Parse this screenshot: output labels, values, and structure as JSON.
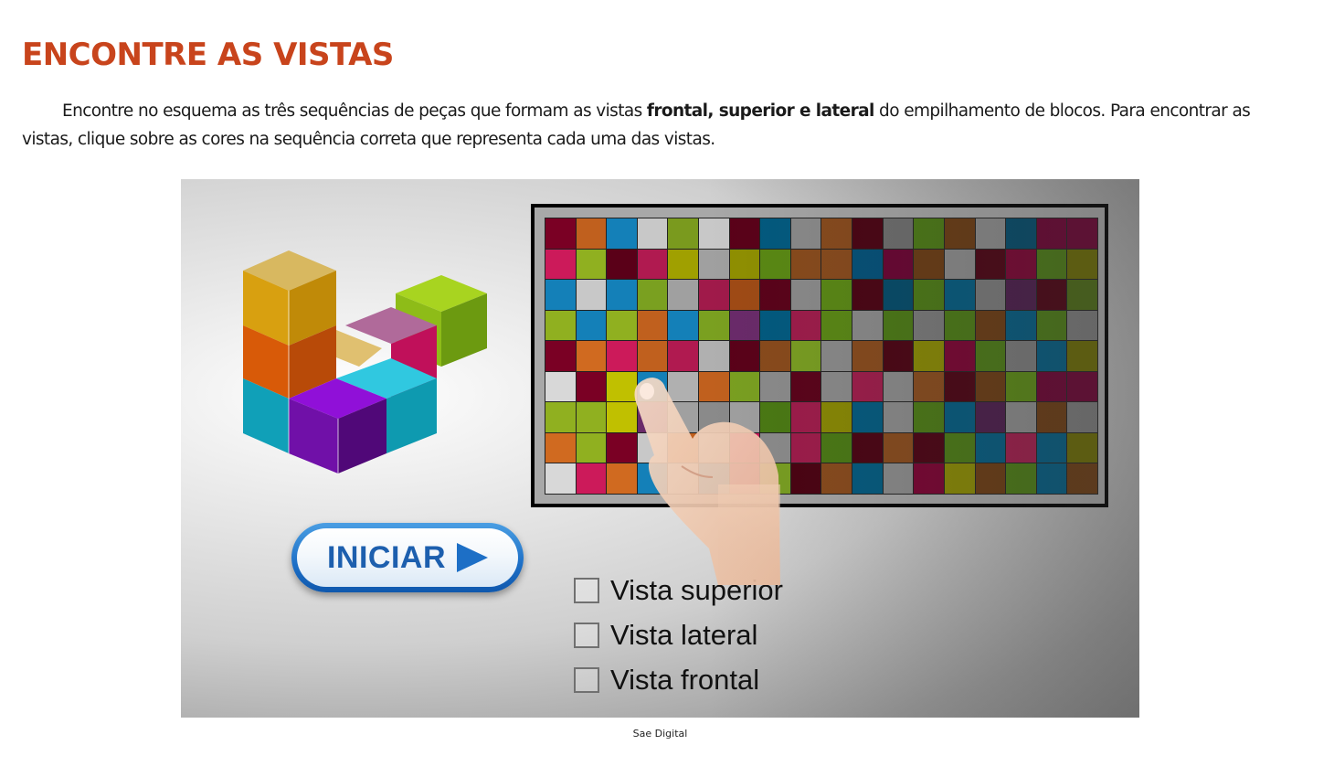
{
  "page": {
    "title": "ENCONTRE AS VISTAS",
    "intro": {
      "part1": "Encontre no esquema as três sequências de peças que formam as vistas ",
      "bold": "frontal, superior e lateral",
      "part2": " do empilhamento de blocos. Para encontrar as vistas, clique sobre as cores na sequência correta que representa cada uma das vistas."
    },
    "credit": "Sae Digital"
  },
  "game": {
    "start_label": "INICIAR",
    "options": [
      {
        "label": "Vista superior",
        "checked": false
      },
      {
        "label": "Vista lateral",
        "checked": false
      },
      {
        "label": "Vista frontal",
        "checked": false
      }
    ],
    "grid": {
      "rows": 9,
      "cols": 18,
      "cells": [
        [
          "#7a0024",
          "#c0601e",
          "#1480b8",
          "#c8c8c8",
          "#7a9a1e",
          "#c8c8c8",
          "#5a0018",
          "#005a80",
          "#8c8c8c",
          "#8a4a1a",
          "#4a0010",
          "#6e6e6e",
          "#4a7a12",
          "#6a3a10",
          "#8c8c8c",
          "#004a6a",
          "#6a0030"
        ],
        [
          "#cc1a5a",
          "#90b020",
          "#5a0018",
          "#b01a50",
          "#a0a000",
          "#a0a0a0",
          "#909000",
          "#5a8a12",
          "#8a4a1a",
          "#8a4a1a",
          "#00507a",
          "#6a0030",
          "#6a3a10",
          "#8c8c8c",
          "#4a0010",
          "#7a0030",
          "#4a7a12",
          "#6a6a00"
        ],
        [
          "#1480b8",
          "#c8c8c8",
          "#1480b8",
          "#7aa020",
          "#a0a0a0",
          "#a01a4a",
          "#a04a14",
          "#5a0018",
          "#8c8c8c",
          "#5a8a12",
          "#4a0010",
          "#004a6a",
          "#4a7a12",
          "#005a80",
          "#7a7a7a",
          "#4a1a4a",
          "#4a0010",
          "#4a6a12"
        ],
        [
          "#90b020",
          "#1480b8",
          "#90b020",
          "#c0601e",
          "#1480b8",
          "#7aa020",
          "#6a2a6a",
          "#005a80",
          "#a01a4a",
          "#5a8a12",
          "#8c8c8c",
          "#4a7a12",
          "#7a7a7a",
          "#4a7a12",
          "#6a3a10",
          "#005a80",
          "#4a7a12",
          "#7a7a7a"
        ],
        [
          "#7a0024",
          "#d06a20",
          "#cc1a5a",
          "#c0601e",
          "#b01a50",
          "#b0b0b0",
          "#5a0018",
          "#8a4a1a",
          "#7aa020",
          "#8c8c8c",
          "#8a4a1a",
          "#4a0010",
          "#8a8a00",
          "#7a0030",
          "#4a7a12",
          "#7a7a7a",
          "#005a80",
          "#6a6a00"
        ],
        [
          "#d8d8d8",
          "#7a0024",
          "#c0c000",
          "#1480b8",
          "#b0b0b0",
          "#c0601e",
          "#7aa020",
          "#8c8c8c",
          "#5a0018",
          "#8c8c8c",
          "#a01a4a",
          "#8c8c8c",
          "#8a4a1a",
          "#4a0010",
          "#6a3a10",
          "#5a8a12",
          "#6a0030"
        ],
        [
          "#90b020",
          "#90b020",
          "#c0c000",
          "#6a2a6a",
          "#a0a0a0",
          "#8a8a8a",
          "#a0a0a0",
          "#4a7a12",
          "#a01a4a",
          "#8a8a00",
          "#005a80",
          "#8c8c8c",
          "#4a7a12",
          "#005a80",
          "#4a1a4a",
          "#8c8c8c",
          "#6a3a10",
          "#7a7a7a",
          "#4a0010"
        ],
        [
          "#d06a20",
          "#90b020",
          "#7a0024",
          "#c8c8c8",
          "#c0601e",
          "#b0b0b0",
          "#cc1a5a",
          "#8c8c8c",
          "#a01a4a",
          "#4a7a12",
          "#4a0010",
          "#8a4a1a",
          "#4a0010",
          "#4a7a12",
          "#005a80",
          "#a01a4a",
          "#005a80",
          "#6a6a00"
        ],
        [
          "#d8d8d8",
          "#cc1a5a",
          "#d06a20",
          "#1480b8",
          "#b0b0b0",
          "#1480b8",
          "#b01a50",
          "#7aa020",
          "#4a0010",
          "#8a4a1a",
          "#005a80",
          "#8c8c8c",
          "#7a0030",
          "#8a8a00",
          "#6a3a10",
          "#4a7a12",
          "#005a80",
          "#6a3a10"
        ]
      ]
    }
  }
}
